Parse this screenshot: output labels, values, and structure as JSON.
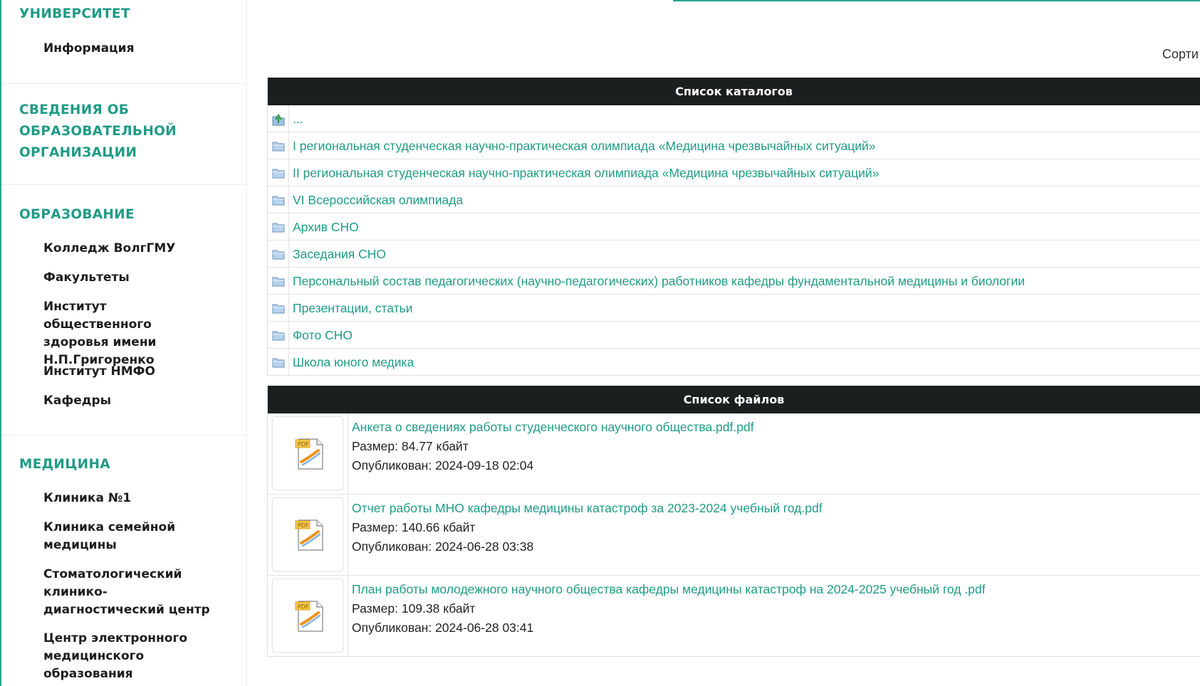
{
  "sidebar": {
    "sections": [
      {
        "heading": "УНИВЕРСИТЕТ",
        "items": [
          "Информация"
        ]
      },
      {
        "heading_lines": [
          "СВЕДЕНИЯ ОБ",
          "ОБРАЗОВАТЕЛЬНОЙ",
          "ОРГАНИЗАЦИИ"
        ],
        "items": []
      },
      {
        "heading": "ОБРАЗОВАНИЕ",
        "items": [
          "Колледж ВолгГМУ",
          "Факультеты",
          "Институт общественного здоровья имени Н.П.Григоренко",
          "Институт НМФО",
          "Кафедры"
        ]
      },
      {
        "heading": "МЕДИЦИНА",
        "items": [
          "Клиника №1",
          "Клиника семейной медицины",
          "Стоматологический клинико-диагностический центр",
          "Центр электронного медицинского образования"
        ]
      }
    ]
  },
  "toolbar": {
    "sort_label": "Сорти"
  },
  "catalogs": {
    "title": "Список каталогов",
    "up_label": "...",
    "items": [
      "I региональная студенческая научно-практическая олимпиада «Медицина чрезвычайных ситуаций»",
      "II региональная студенческая научно-практическая олимпиада «Медицина чрезвычайных ситуаций»",
      "VI Всероссийская олимпиада",
      "Архив СНО",
      "Заседания СНО",
      "Персональный состав педагогических (научно-педагогических) работников кафедры фундаментальной медицины и биологии",
      "Презентации, статьи",
      "Фото СНО",
      "Школа юного медика"
    ]
  },
  "files": {
    "title": "Список файлов",
    "items": [
      {
        "name": "Анкета о сведениях работы студенческого научного общества.pdf.pdf",
        "size": "Размер: 84.77 кбайт",
        "published": "Опубликован: 2024-09-18 02:04"
      },
      {
        "name": "Отчет работы МНО кафедры медицины катастроф за 2023-2024 учебный год.pdf",
        "size": "Размер: 140.66 кбайт",
        "published": "Опубликован: 2024-06-28 03:38"
      },
      {
        "name": "План работы молодежного научного общества кафедры медицины катастроф на 2024-2025 учебный год .pdf",
        "size": "Размер: 109.38 кбайт",
        "published": "Опубликован: 2024-06-28 03:41"
      }
    ]
  },
  "colors": {
    "accent": "#1f9b86",
    "header_bg": "#1c1f1f",
    "text": "#222222"
  },
  "icons": {
    "folder": "folder-icon",
    "up": "folder-up-icon",
    "pdf": "pdf-file-icon"
  }
}
